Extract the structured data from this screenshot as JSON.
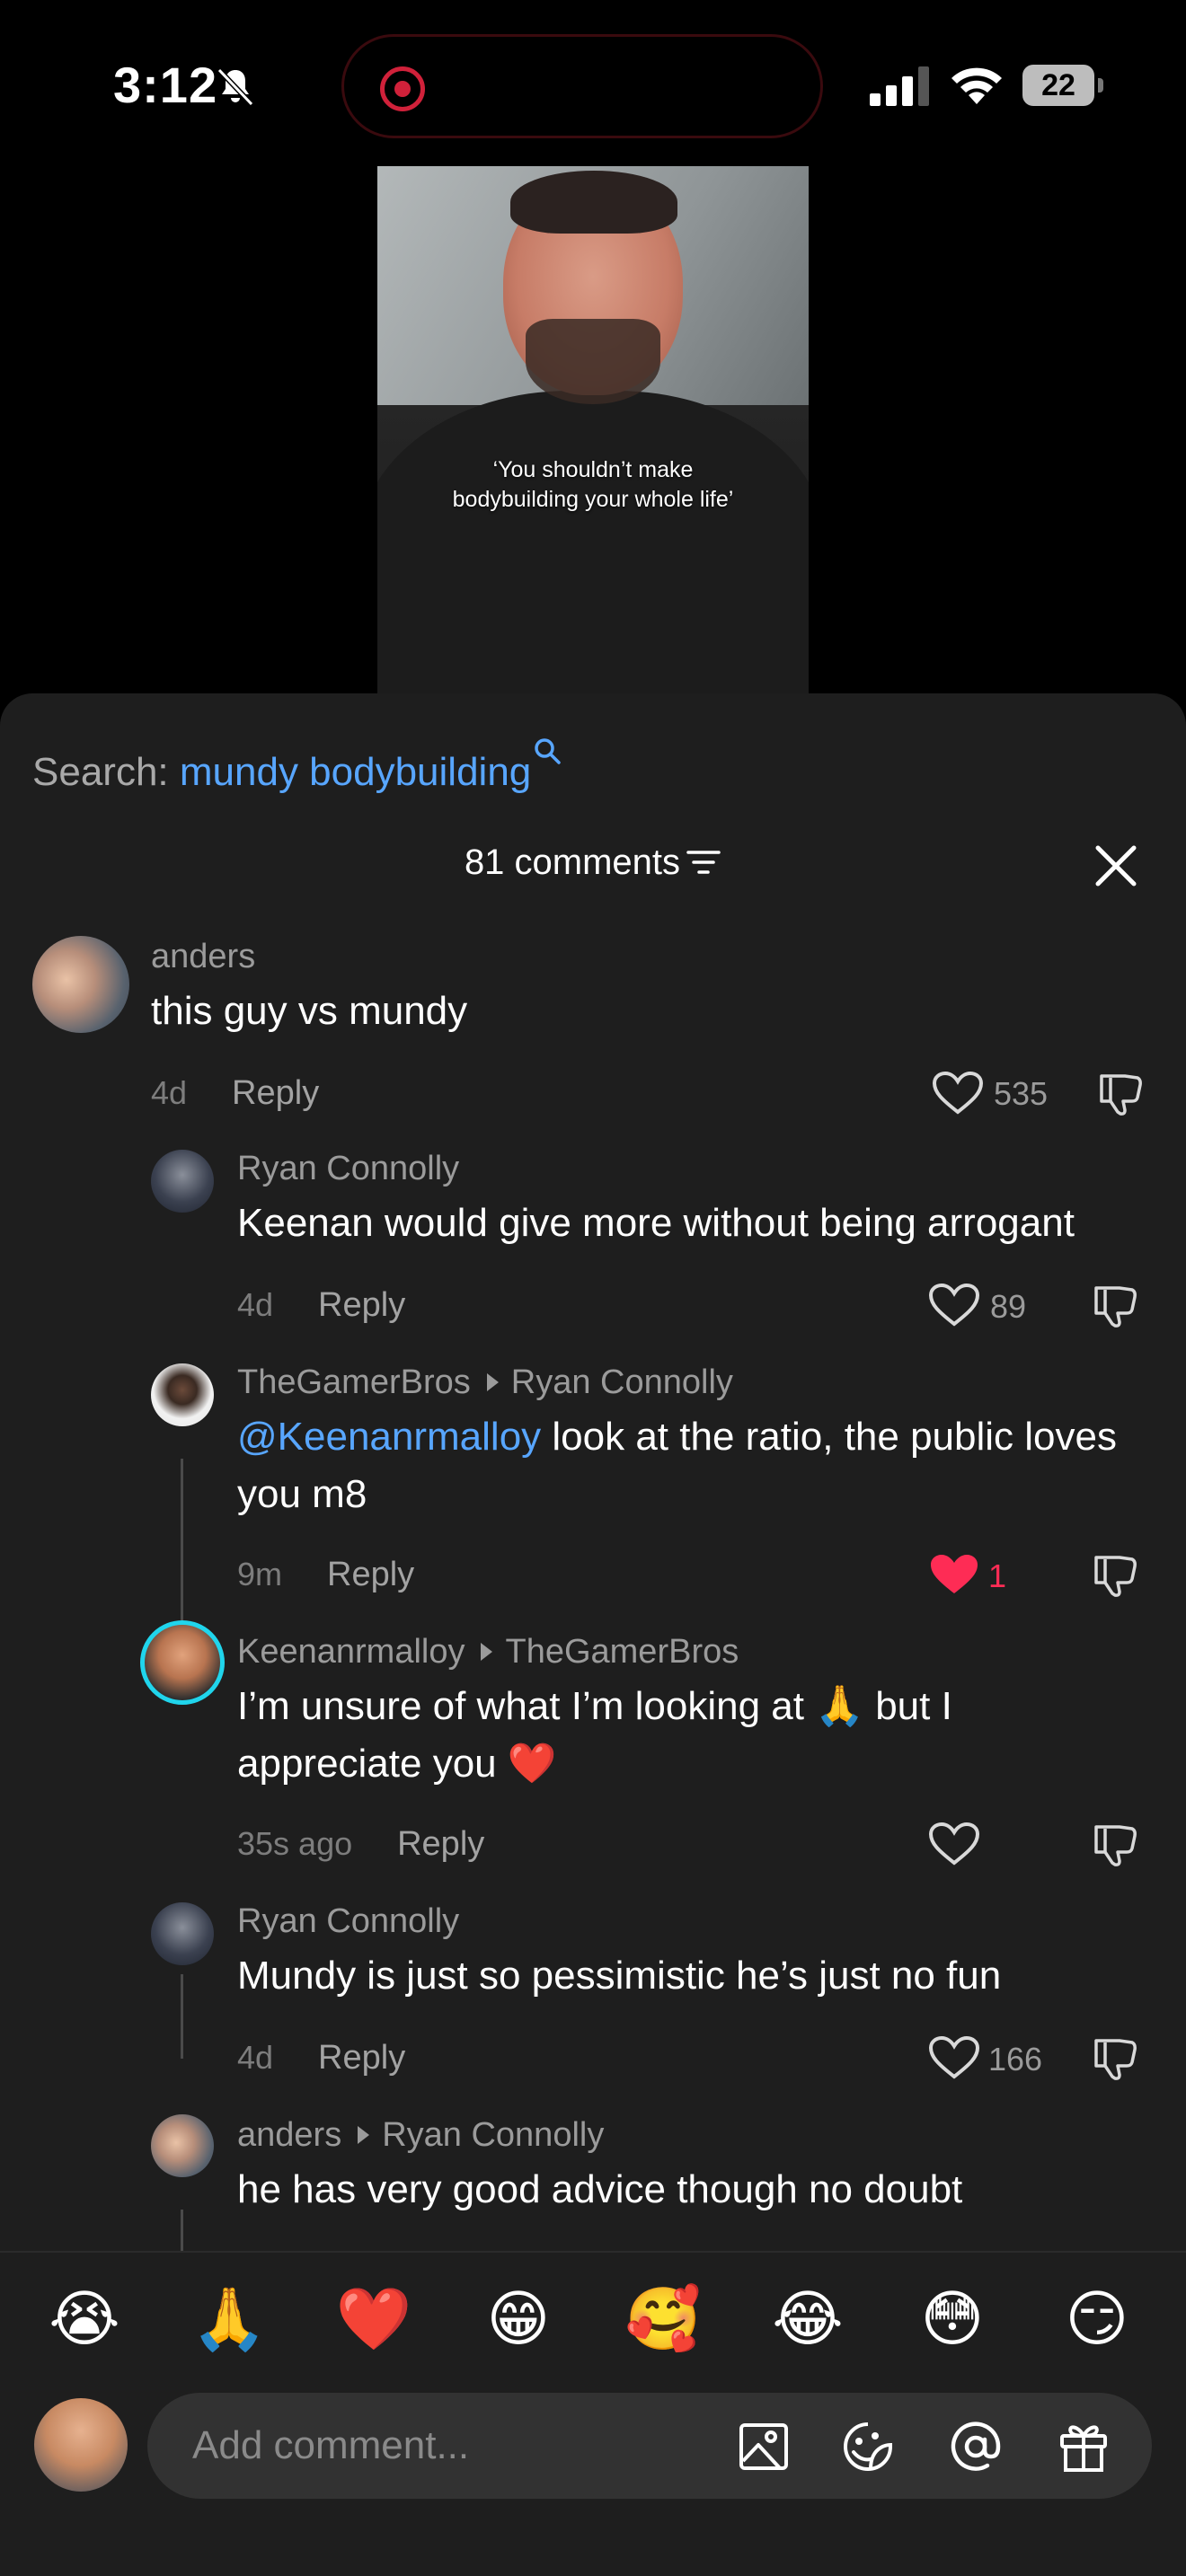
{
  "status_bar": {
    "time": "3:12",
    "battery": "22"
  },
  "video": {
    "caption": "‘You shouldn’t make bodybuilding your whole life’"
  },
  "search": {
    "label": "Search:",
    "query": "mundy bodybuilding"
  },
  "comments_header": {
    "count_label": "81 comments"
  },
  "comments": [
    {
      "user": "anders",
      "reply_to": "",
      "text": "this guy vs mundy",
      "time": "4d",
      "reply": "Reply",
      "likes": "535"
    },
    {
      "user": "Ryan Connolly",
      "reply_to": "",
      "text": "Keenan would give more without being arrogant",
      "time": "4d",
      "reply": "Reply",
      "likes": "89"
    },
    {
      "user": "TheGamerBros",
      "reply_to": "Ryan Connolly",
      "mention": "@Keenanrmalloy",
      "text": " look at the ratio, the public loves you m8",
      "time": "9m",
      "reply": "Reply",
      "likes": "1"
    },
    {
      "user": "Keenanrmalloy",
      "reply_to": "TheGamerBros",
      "text_a": "I’m unsure of what I’m looking at ",
      "emoji_a": "🙏",
      "text_b": " but I appreciate you ",
      "emoji_b": "❤️",
      "time": "35s ago",
      "reply": "Reply",
      "likes": ""
    },
    {
      "user": "Ryan Connolly",
      "reply_to": "",
      "text": "Mundy is just so pessimistic he’s just no fun",
      "time": "4d",
      "reply": "Reply",
      "likes": "166"
    },
    {
      "user": "anders",
      "reply_to": "Ryan Connolly",
      "text": "he has very good advice though no doubt",
      "time": "",
      "reply": "",
      "likes": ""
    }
  ],
  "emoji_bar": [
    "😭",
    "🙏",
    "❤️",
    "😁",
    "🥰",
    "😂",
    "😳",
    "😏"
  ],
  "composer": {
    "placeholder": "Add comment..."
  },
  "colors": {
    "accent": "#58a6ff",
    "liked": "#fe2c55",
    "sheet_bg": "#1e1e1e",
    "story_ring": "#20d5ec"
  },
  "icons": [
    "bell-muted-icon",
    "record-icon",
    "signal-icon",
    "wifi-icon",
    "battery-icon",
    "search-icon",
    "filter-icon",
    "close-icon",
    "heart-icon",
    "dislike-icon",
    "image-icon",
    "sticker-icon",
    "at-icon",
    "gift-icon"
  ]
}
